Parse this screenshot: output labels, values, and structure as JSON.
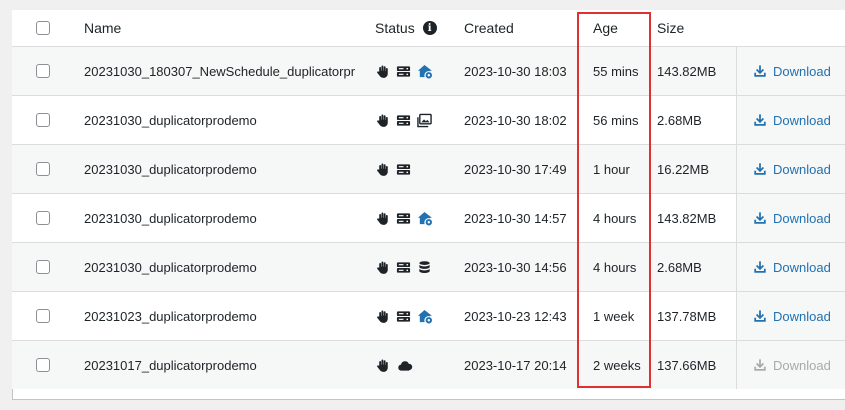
{
  "header": {
    "name": "Name",
    "status": "Status",
    "created": "Created",
    "age": "Age",
    "size": "Size"
  },
  "colors": {
    "accent": "#2271b1",
    "highlight": "#e03030",
    "disabled": "#a7aaad"
  },
  "rows": [
    {
      "name": "20231030_180307_NewSchedule_duplicatorpr",
      "icons": [
        "hand-icon",
        "server-icon",
        "house-gear-icon"
      ],
      "created": "2023-10-30 18:03",
      "age": "55 mins",
      "size": "143.82MB",
      "download": "Download",
      "disabled": false
    },
    {
      "name": "20231030_duplicatorprodemo",
      "icons": [
        "hand-icon",
        "server-icon",
        "images-icon"
      ],
      "created": "2023-10-30 18:02",
      "age": "56 mins",
      "size": "2.68MB",
      "download": "Download",
      "disabled": false
    },
    {
      "name": "20231030_duplicatorprodemo",
      "icons": [
        "hand-icon",
        "server-icon"
      ],
      "created": "2023-10-30 17:49",
      "age": "1 hour",
      "size": "16.22MB",
      "download": "Download",
      "disabled": false
    },
    {
      "name": "20231030_duplicatorprodemo",
      "icons": [
        "hand-icon",
        "server-icon",
        "house-gear-icon"
      ],
      "created": "2023-10-30 14:57",
      "age": "4 hours",
      "size": "143.82MB",
      "download": "Download",
      "disabled": false
    },
    {
      "name": "20231030_duplicatorprodemo",
      "icons": [
        "hand-icon",
        "server-icon",
        "database-icon"
      ],
      "created": "2023-10-30 14:56",
      "age": "4 hours",
      "size": "2.68MB",
      "download": "Download",
      "disabled": false
    },
    {
      "name": "20231023_duplicatorprodemo",
      "icons": [
        "hand-icon",
        "server-icon",
        "house-gear-icon"
      ],
      "created": "2023-10-23 12:43",
      "age": "1 week",
      "size": "137.78MB",
      "download": "Download",
      "disabled": false
    },
    {
      "name": "20231017_duplicatorprodemo",
      "icons": [
        "hand-icon",
        "cloud-icon"
      ],
      "created": "2023-10-17 20:14",
      "age": "2 weeks",
      "size": "137.66MB",
      "download": "Download",
      "disabled": true
    }
  ]
}
